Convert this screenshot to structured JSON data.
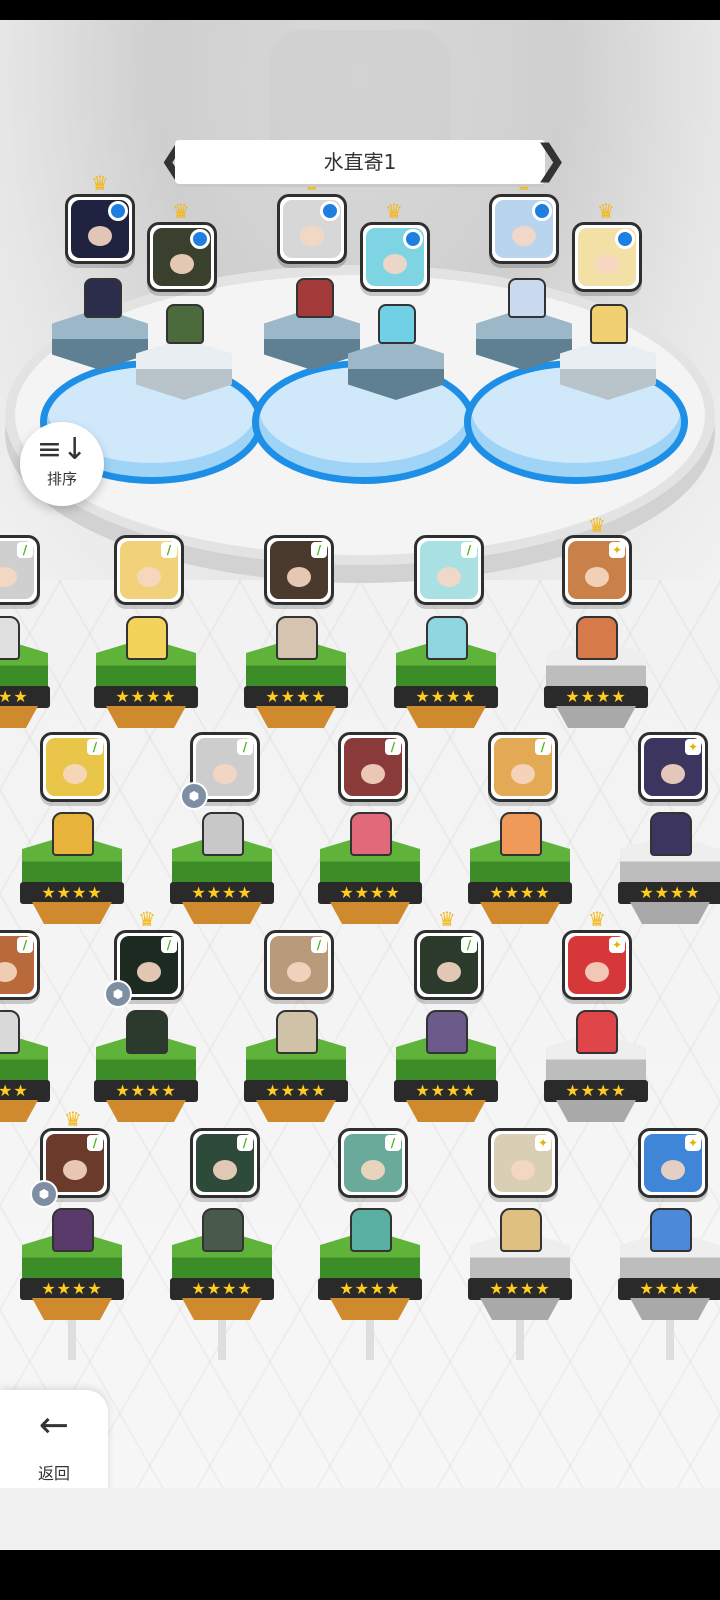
{
  "team": {
    "title": "水直寄1",
    "prev_arrow": "❮",
    "next_arrow": "❯"
  },
  "sort_button": {
    "icon": "≡↓",
    "label": "排序"
  },
  "back_button": {
    "icon": "←",
    "label": "返回"
  },
  "stars_text": "★★★★",
  "roster": {
    "rows": [
      {
        "cells": [
          "leaf",
          "leaf",
          "leaf",
          "leaf",
          "spark"
        ]
      },
      {
        "cells": [
          "leaf",
          "leaf",
          "leaf",
          "leaf",
          "spark"
        ]
      },
      {
        "cells": [
          "leaf",
          "leaf",
          "leaf",
          "leaf",
          "spark"
        ]
      },
      {
        "cells": [
          "leaf",
          "leaf",
          "leaf",
          "spark",
          "spark"
        ]
      }
    ]
  },
  "colors": {
    "accent_blue": "#1e8fe6",
    "crown_gold": "#f3b81d",
    "star_yellow": "#ffcc1f",
    "grass_green": "#5fb33a"
  }
}
